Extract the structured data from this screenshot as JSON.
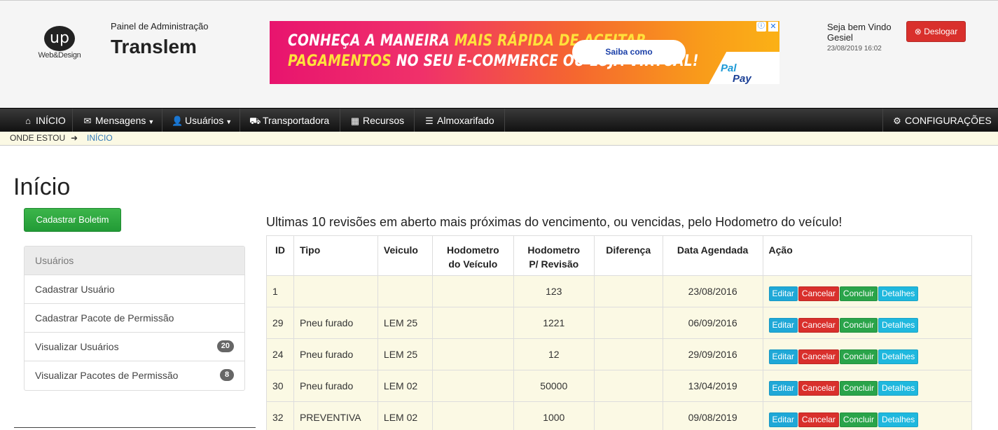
{
  "header": {
    "logo_mark": "up",
    "logo_text": "Web&Design",
    "admin_subtitle": "Painel de Administração",
    "site_title": "Translem",
    "welcome": "Seja bem Vindo Gesiel",
    "datetime": "23/08/2019 16:02",
    "logout_label": "Deslogar"
  },
  "ad": {
    "line1_a": "CONHEÇA A MANEIRA ",
    "line1_b": "MAIS RÁPIDA DE ACEITAR",
    "line2_a": "PAGAMENTOS",
    "line2_b": " NO SEU E-COMMERCE OU LOJA VIRTUAL!",
    "cta": "Saiba como",
    "brand_a": "Pay",
    "brand_b": "Pal"
  },
  "nav": {
    "home": "INÍCIO",
    "messages": "Mensagens",
    "users": "Usuários",
    "carrier": "Transportadora",
    "resources": "Recursos",
    "warehouse": "Almoxarifado",
    "settings": "CONFIGURAÇÕES"
  },
  "breadcrumb": {
    "here": "ONDE ESTOU",
    "current": "INÍCIO"
  },
  "page": {
    "title": "Início",
    "register_button": "Cadastrar Boletim"
  },
  "sidebar": {
    "heading": "Usuários",
    "items": [
      {
        "label": "Cadastrar Usuário",
        "badge": ""
      },
      {
        "label": "Cadastrar Pacote de Permissão",
        "badge": ""
      },
      {
        "label": "Visualizar Usuários",
        "badge": "20"
      },
      {
        "label": "Visualizar Pacotes de Permissão",
        "badge": "8"
      }
    ]
  },
  "table": {
    "title": "Ultimas 10 revisões em aberto mais próximas do vencimento, ou vencidas, pelo Hodometro do veículo!",
    "headers": {
      "id": "ID",
      "type": "Tipo",
      "vehicle": "Veiculo",
      "odo_vehicle_1": "Hodometro",
      "odo_vehicle_2": "do Veículo",
      "odo_rev_1": "Hodometro",
      "odo_rev_2": "P/ Revisão",
      "diff": "Diferença",
      "date": "Data Agendada",
      "action": "Ação"
    },
    "actions": {
      "edit": "Editar",
      "cancel": "Cancelar",
      "done": "Concluir",
      "details": "Detalhes"
    },
    "rows": [
      {
        "id": "1",
        "type": "",
        "vehicle": "",
        "odo_vehicle": "",
        "odo_rev": "123",
        "diff": "",
        "date": "23/08/2016"
      },
      {
        "id": "29",
        "type": "Pneu furado",
        "vehicle": "LEM 25",
        "odo_vehicle": "",
        "odo_rev": "1221",
        "diff": "",
        "date": "06/09/2016"
      },
      {
        "id": "24",
        "type": "Pneu furado",
        "vehicle": "LEM 25",
        "odo_vehicle": "",
        "odo_rev": "12",
        "diff": "",
        "date": "29/09/2016"
      },
      {
        "id": "30",
        "type": "Pneu furado",
        "vehicle": "LEM 02",
        "odo_vehicle": "",
        "odo_rev": "50000",
        "diff": "",
        "date": "13/04/2019"
      },
      {
        "id": "32",
        "type": "PREVENTIVA",
        "vehicle": "LEM 02",
        "odo_vehicle": "",
        "odo_rev": "1000",
        "diff": "",
        "date": "09/08/2019"
      }
    ]
  }
}
